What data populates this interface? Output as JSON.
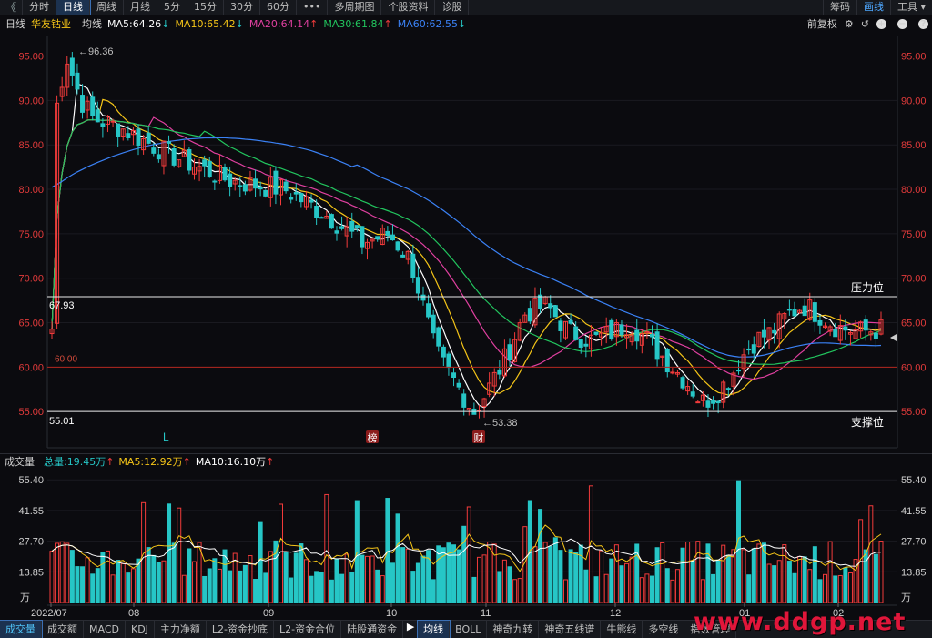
{
  "topbar": {
    "tabs": [
      "分时",
      "日线",
      "周线",
      "月线",
      "5分",
      "15分",
      "30分",
      "60分",
      "•••",
      "多周期图",
      "个股资料",
      "诊股"
    ],
    "active": "日线",
    "right_tabs": [
      "筹码",
      "画线",
      "工具"
    ]
  },
  "ma_header": {
    "period": "日线",
    "stock": "华友钴业",
    "type": "均线",
    "ma5": "MA5:64.26",
    "ma10": "MA10:65.42",
    "ma20": "MA20:64.14",
    "ma30": "MA30:61.84",
    "ma60": "MA60:62.55",
    "adj": "前复权"
  },
  "volume_header": {
    "name": "成交量",
    "total": "总量:19.45万",
    "ma5": "MA5:12.92万",
    "ma10": "MA10:16.10万"
  },
  "bottom_tabs": [
    "成交量",
    "成交额",
    "MACD",
    "KDJ",
    "主力净额",
    "L2-资金抄底",
    "L2-资金合位",
    "陆股通资金",
    "均线",
    "BOLL",
    "神奇九转",
    "神奇五线谱",
    "牛熊线",
    "多空线",
    "指数管理"
  ],
  "watermark": "www.ddgp.net",
  "colors": {
    "up": "#f23b3b",
    "down": "#26c6c6",
    "ma5": "#ffffff",
    "ma10": "#f5c518",
    "ma20": "#e040a0",
    "ma30": "#22c55e",
    "ma60": "#3b82f6",
    "bg": "#0b0b0f"
  },
  "chart_data": [
    {
      "type": "candlestick",
      "price_ylim": [
        54,
        97
      ],
      "price_ticks": [
        "95.00",
        "90.00",
        "85.00",
        "80.00",
        "75.00",
        "70.00",
        "65.00",
        "60.00",
        "55.00"
      ],
      "months": [
        "2022/07",
        "08",
        "09",
        "10",
        "11",
        "12",
        "01",
        "02"
      ],
      "annotations": {
        "high": "96.36",
        "low": "53.38",
        "pressure_label": "压力位",
        "pressure_value": "67.93",
        "support_label": "支撑位",
        "support_value": "55.01",
        "level_value": "60.00",
        "marker_L": "L",
        "marker_bang": "榜",
        "marker_cai": "财"
      },
      "x_values": [
        0.1,
        0.6,
        1.2,
        1.7,
        2.8,
        4.8,
        7.3,
        9.6,
        11.4,
        12.8,
        13.9,
        14.8,
        15.4,
        15.8,
        16.2,
        16.7,
        17.4,
        17.9,
        18.7,
        19.5,
        20.4,
        21.3,
        22.3,
        23.2,
        23.8,
        24.6,
        25.6,
        26.3,
        26.8,
        27.4,
        28.0,
        28.4,
        29.0,
        29.7,
        30.4,
        31.0,
        31.6,
        32.4,
        33.3,
        34.2
      ],
      "x_unit": "trading-week index (approximate)",
      "close_approx": [
        88,
        95,
        90,
        88,
        87,
        84,
        81,
        80,
        77,
        74,
        75,
        72,
        66,
        62,
        60,
        58,
        55,
        57,
        61,
        66,
        67,
        64,
        63,
        64,
        65,
        63,
        60,
        58,
        56,
        57,
        59,
        61,
        63,
        64,
        66,
        67,
        66,
        64.5,
        64,
        64.3
      ],
      "series": [
        {
          "name": "MA5",
          "value": 64.26
        },
        {
          "name": "MA10",
          "value": 65.42
        },
        {
          "name": "MA20",
          "value": 64.14
        },
        {
          "name": "MA30",
          "value": 61.84
        },
        {
          "name": "MA60",
          "value": 62.55
        }
      ]
    },
    {
      "type": "bar",
      "name": "成交量",
      "unit": "万",
      "volume_ticks": [
        "55.40",
        "41.55",
        "27.70",
        "13.85"
      ],
      "ylim": [
        0,
        60
      ],
      "values": [
        19.45,
        12.92,
        16.1
      ]
    }
  ]
}
